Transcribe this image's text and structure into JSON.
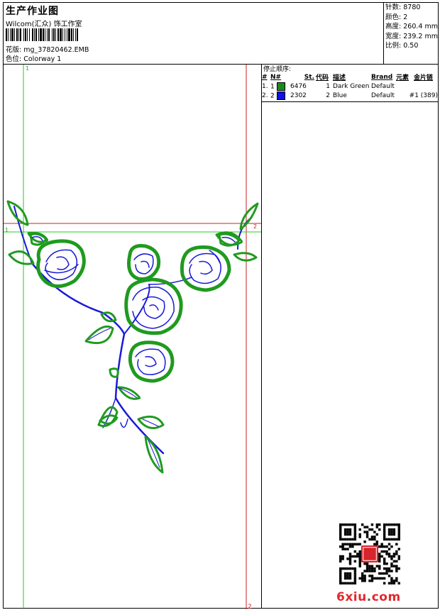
{
  "header": {
    "title": "生产作业图",
    "studio": "Wilcom(汇众) 饰工作室",
    "design_label": "花版:",
    "design_value": "mg_37820462.EMB",
    "colorway_label": "色位:",
    "colorway_value": "Colorway 1"
  },
  "stats": [
    {
      "label": "针数:",
      "value": "8780"
    },
    {
      "label": "颜色:",
      "value": "2"
    },
    {
      "label": "高度:",
      "value": "260.4 mm"
    },
    {
      "label": "宽度:",
      "value": "239.2 mm"
    },
    {
      "label": "比例:",
      "value": "0.50"
    }
  ],
  "stop_sequence": {
    "caption": "停止顺序:",
    "columns": [
      "#",
      "N#",
      "St.",
      "代码",
      "描述",
      "Brand",
      "元素",
      "金片链"
    ],
    "rows": [
      {
        "index": "1.",
        "n": "1",
        "code": "6476",
        "st": "1",
        "desc": "Dark Green",
        "brand": "Default",
        "element": "",
        "sequin": "",
        "color": "#1a8a1a"
      },
      {
        "index": "2.",
        "n": "2",
        "code": "2302",
        "st": "2",
        "desc": "Blue",
        "brand": "Default",
        "element": "#1 (389)",
        "sequin": "",
        "color": "#1010e0"
      }
    ]
  },
  "canvas": {
    "guide_top_left": "1",
    "guide_left_mid": "1",
    "guide_right_mid": "2",
    "guide_bottom_right": "2",
    "colors": {
      "green": "#1f9a1f",
      "blue": "#1a1ad8",
      "guide_green": "#22cc22",
      "guide_red": "#cc2222"
    }
  },
  "watermark": {
    "brand_number": "6",
    "brand_text": "xiu",
    "brand_dot": ".",
    "brand_tld": "com"
  }
}
